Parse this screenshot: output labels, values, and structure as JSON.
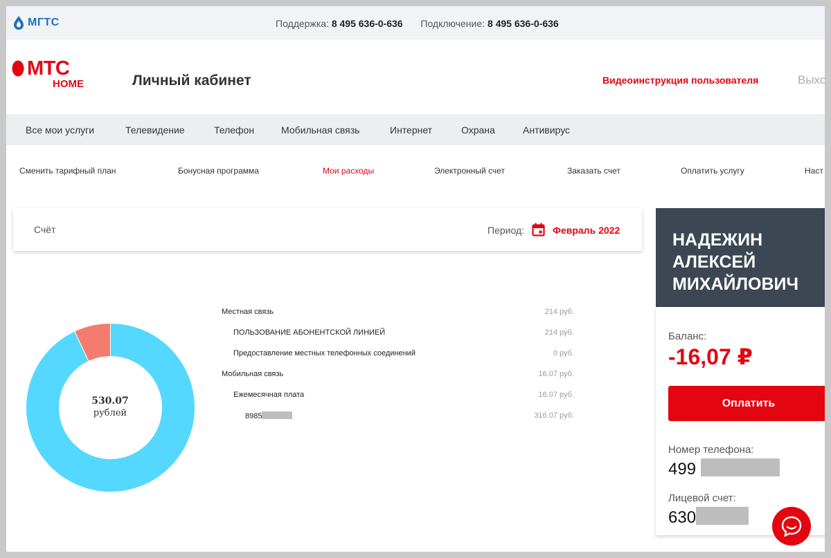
{
  "topbar": {
    "logo_text": "МГТС",
    "support_label": "Поддержка:",
    "support_phone": "8 495 636-0-636",
    "connect_label": "Подключение:",
    "connect_phone": "8 495 636-0-636"
  },
  "header": {
    "logo_mts": "МТС",
    "logo_home": "HOME",
    "title": "Личный кабинет",
    "video_link": "Видеоинструкция пользователя",
    "logout": "Выход"
  },
  "main_nav": [
    "Все мои услуги",
    "Телевидение",
    "Телефон",
    "Мобильная связь",
    "Интернет",
    "Охрана",
    "Антивирус"
  ],
  "sub_nav": {
    "items": [
      "Сменить тарифный план",
      "Бонусная программа",
      "Мои расходы",
      "Электронный счет",
      "Заказать счет",
      "Оплатить услугу",
      "Наст"
    ],
    "active_index": 2
  },
  "account_card": {
    "label": "Счёт",
    "period_label": "Период:",
    "period_value": "Февраль 2022"
  },
  "chart_data": {
    "type": "pie",
    "donut": true,
    "total": "530.07",
    "unit": "рублей",
    "slices": [
      {
        "label": "Местная связь",
        "value": 214,
        "color": "#54d8ff"
      },
      {
        "label": "Мобильная связь",
        "value": 16.07,
        "color": "#f47c6e"
      }
    ]
  },
  "expenses": [
    {
      "name": "Местная связь",
      "amount": "214 руб.",
      "level": 0
    },
    {
      "name": "ПОЛЬЗОВАНИЕ АБОНЕНТСКОЙ ЛИНИЕЙ",
      "amount": "214 руб.",
      "level": 1
    },
    {
      "name": "Предоставление местных телефонных соединений",
      "amount": "0 руб.",
      "level": 1
    },
    {
      "name": "Мобильная связь",
      "amount": "16.07 руб.",
      "level": 0
    },
    {
      "name": "Ежемесячная плата",
      "amount": "16.07 руб.",
      "level": 1
    },
    {
      "name": "8985",
      "amount": "316.07 руб.",
      "level": 2,
      "masked": true
    }
  ],
  "profile": {
    "name_lines": [
      "НАДЕЖИН",
      "АЛЕКСЕЙ",
      "МИХАЙЛОВИЧ"
    ],
    "balance_label": "Баланс:",
    "balance": "-16,07 ₽",
    "pay_button": "Оплатить",
    "phone_label": "Номер телефона:",
    "phone_value": "499",
    "account_label": "Лицевой счет:",
    "account_value": "630"
  },
  "colors": {
    "brand_red": "#e30611",
    "profile_dark": "#3d4653",
    "donut_blue": "#54d8ff",
    "donut_salmon": "#f47c6e"
  },
  "icons": [
    "water-drop-icon",
    "calendar-icon",
    "chat-icon"
  ]
}
